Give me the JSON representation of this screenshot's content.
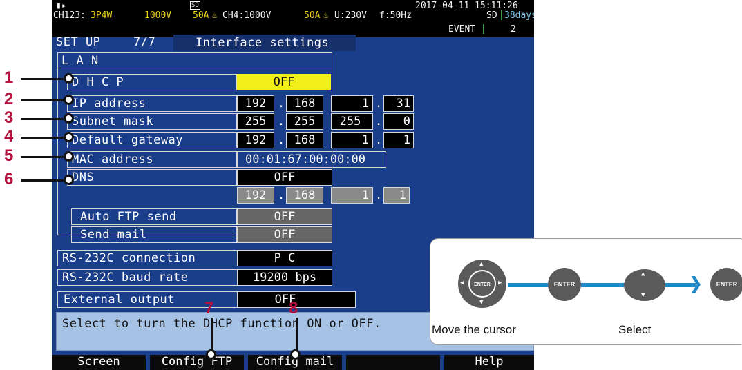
{
  "status": {
    "datetime": "2017-04-11 15:11:26",
    "ch123_label": "CH123:",
    "wiring": "3P4W",
    "range1": "1000V",
    "current1": "50A",
    "ch4": "CH4:1000V",
    "current2": "50A",
    "u_label": "U:230V",
    "f_label": "f:50Hz",
    "sd_label": "SD",
    "sd_days": "38days",
    "event_label": "EVENT",
    "event_count": "2",
    "sd_card_icon": "SD"
  },
  "header": {
    "screen": "SET UP",
    "page": "7/7",
    "title": "Interface settings"
  },
  "lan": {
    "section": "L A N",
    "dhcp_label": "D H C P",
    "dhcp_value": "OFF",
    "ip_label": "IP address",
    "ip": [
      "192",
      "168",
      "1",
      "31"
    ],
    "subnet_label": "Subnet mask",
    "subnet": [
      "255",
      "255",
      "255",
      "0"
    ],
    "gateway_label": "Default gateway",
    "gateway": [
      "192",
      "168",
      "1",
      "1"
    ],
    "mac_label": "MAC address",
    "mac": "00:01:67:00:00:00",
    "dns_label": "DNS",
    "dns_value": "OFF",
    "dns_ip": [
      "192",
      "168",
      "1",
      "1"
    ],
    "ftp_label": "Auto FTP send",
    "ftp_value": "OFF",
    "mail_label": "Send mail",
    "mail_value": "OFF"
  },
  "rs232": {
    "conn_label": "RS-232C connection",
    "conn_value": "P C",
    "baud_label": "RS-232C baud rate",
    "baud_value": "19200 bps"
  },
  "ext": {
    "label": "External output",
    "value": "OFF"
  },
  "help_text": "Select to turn the DHCP function ON or OFF.",
  "fkeys": [
    "Screen",
    "Config FTP",
    "Config mail",
    "",
    "Help"
  ],
  "callouts": [
    "1",
    "2",
    "3",
    "4",
    "5",
    "6",
    "7",
    "8"
  ],
  "legend": {
    "move": "Move the cursor",
    "select": "Select",
    "enter1": "ENTER",
    "enter2": "ENTER",
    "enter3": "ENTER"
  },
  "colors": {
    "screen_bg": "#1a3e8a",
    "highlight": "#f2ee1a",
    "callout": "#b4123c",
    "arrow": "#1f88c9"
  }
}
